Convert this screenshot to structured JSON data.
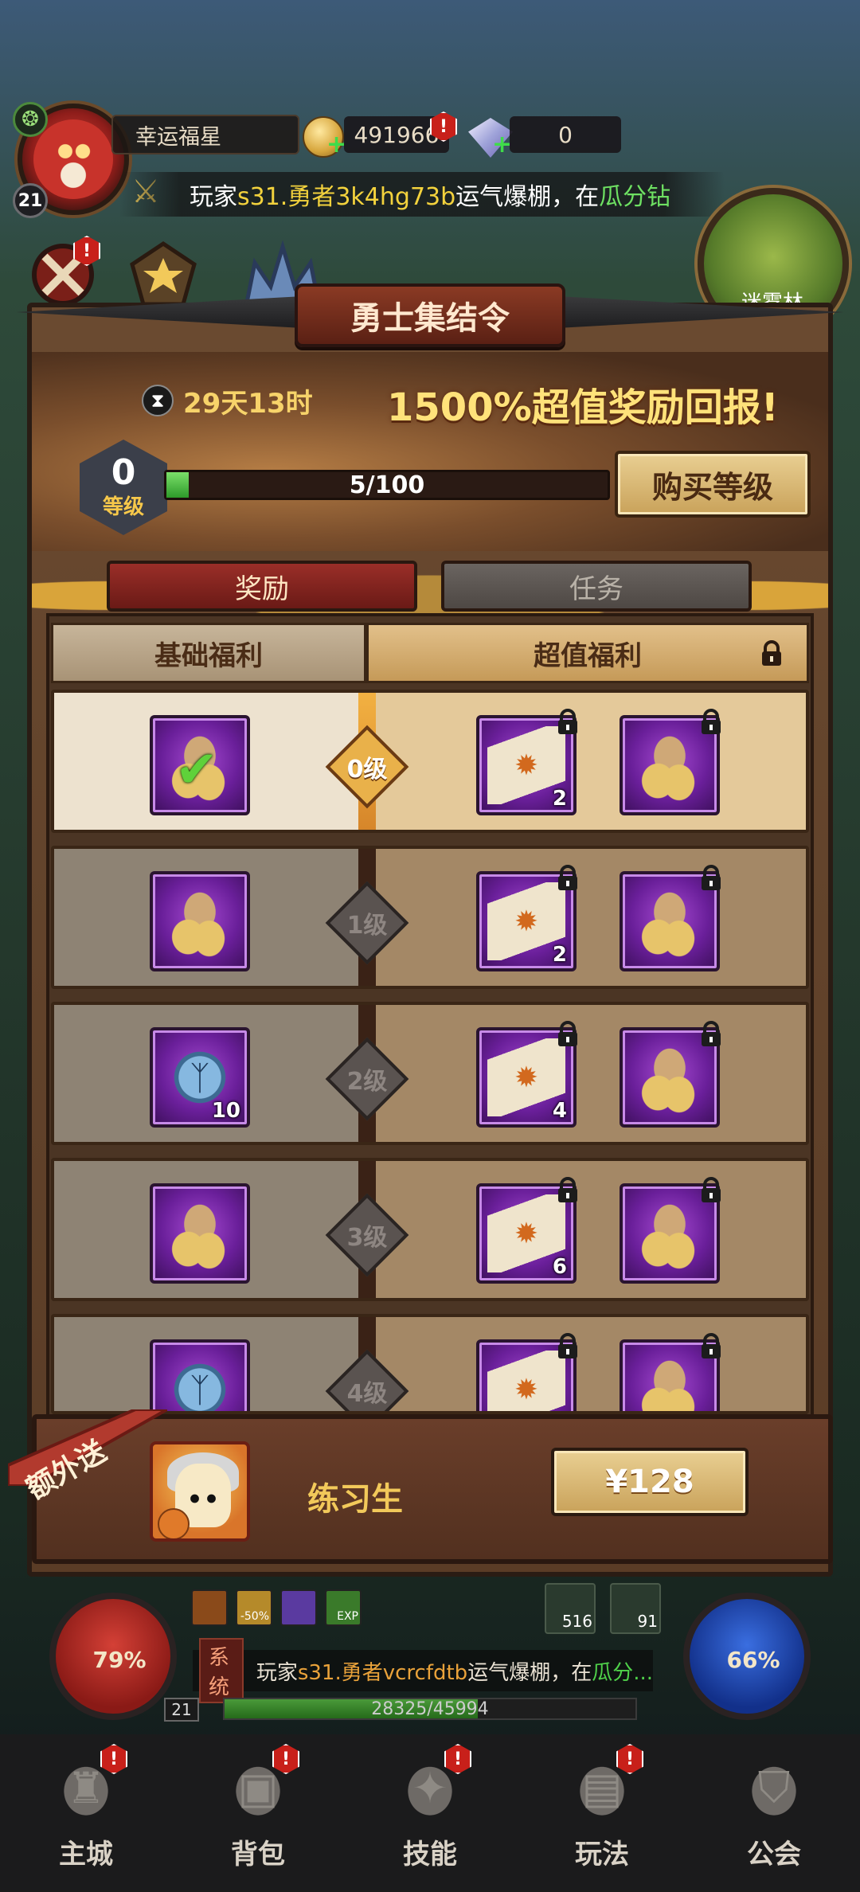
{
  "hud": {
    "player_name": "幸运福星",
    "player_level": "21",
    "gold": "491966",
    "gems": "0",
    "marquee": {
      "prefix": "玩家",
      "player": "s31.勇者3k4hg73b",
      "middle": "运气爆棚，在",
      "event": "瓜分钻"
    },
    "minimap_label": "迷雾林"
  },
  "panel": {
    "title": "勇士集结令",
    "time_left": "29天13时",
    "promo": "1500%超值奖励回报!",
    "level_value": "0",
    "level_label": "等级",
    "progress_text": "5/100",
    "progress_fraction": 0.05,
    "buy_level_label": "购买等级",
    "tabs": [
      {
        "label": "奖励",
        "active": true
      },
      {
        "label": "任务",
        "active": false
      }
    ],
    "columns": {
      "base": "基础福利",
      "premium": "超值福利"
    },
    "rows": [
      {
        "level": "0级",
        "unlocked": true,
        "base": {
          "icon": "coin-bag",
          "qty": "",
          "claimed": true
        },
        "premium": [
          {
            "icon": "scroll-ticket",
            "qty": "2"
          },
          {
            "icon": "coin-bag",
            "qty": ""
          }
        ]
      },
      {
        "level": "1级",
        "unlocked": false,
        "base": {
          "icon": "coin-bag",
          "qty": "",
          "claimed": false
        },
        "premium": [
          {
            "icon": "scroll-ticket",
            "qty": "2"
          },
          {
            "icon": "coin-bag",
            "qty": ""
          }
        ]
      },
      {
        "level": "2级",
        "unlocked": false,
        "base": {
          "icon": "rune-stone",
          "qty": "10",
          "claimed": false
        },
        "premium": [
          {
            "icon": "scroll-ticket",
            "qty": "4"
          },
          {
            "icon": "coin-bag",
            "qty": ""
          }
        ]
      },
      {
        "level": "3级",
        "unlocked": false,
        "base": {
          "icon": "coin-bag",
          "qty": "",
          "claimed": false
        },
        "premium": [
          {
            "icon": "scroll-ticket",
            "qty": "6"
          },
          {
            "icon": "coin-bag",
            "qty": ""
          }
        ]
      },
      {
        "level": "4级",
        "unlocked": false,
        "base": {
          "icon": "rune-stone",
          "qty": "",
          "claimed": false
        },
        "premium": [
          {
            "icon": "scroll-ticket",
            "qty": ""
          },
          {
            "icon": "coin-bag",
            "qty": ""
          }
        ]
      }
    ]
  },
  "offer": {
    "ribbon": "额外送",
    "hero_name": "练习生",
    "price": "¥128"
  },
  "status": {
    "hp_percent": "79%",
    "mp_percent": "66%",
    "buffs": [
      "",
      "-50%",
      "",
      "EXP"
    ],
    "potions": [
      {
        "icon": "red-potion",
        "count": "516"
      },
      {
        "icon": "blue-potion",
        "count": "91"
      }
    ],
    "chat_tag": "系统",
    "chat": {
      "prefix": "玩家",
      "player": "s31.勇者vcrcfdtb",
      "middle": "运气爆棚，在",
      "event": "瓜分..."
    },
    "char_level": "21",
    "xp_text": "28325/45994",
    "xp_fraction": 0.616
  },
  "nav": [
    {
      "label": "主城",
      "icon": "castle-icon",
      "alert": true
    },
    {
      "label": "背包",
      "icon": "bag-icon",
      "alert": true
    },
    {
      "label": "技能",
      "icon": "skill-book-icon",
      "alert": true
    },
    {
      "label": "玩法",
      "icon": "map-scroll-icon",
      "alert": true
    },
    {
      "label": "公会",
      "icon": "guild-shield-icon",
      "alert": false
    }
  ],
  "colors": {
    "accent_gold": "#f2c95a",
    "alert_red": "#c8201a",
    "premium_purple": "#6a1f9a"
  }
}
